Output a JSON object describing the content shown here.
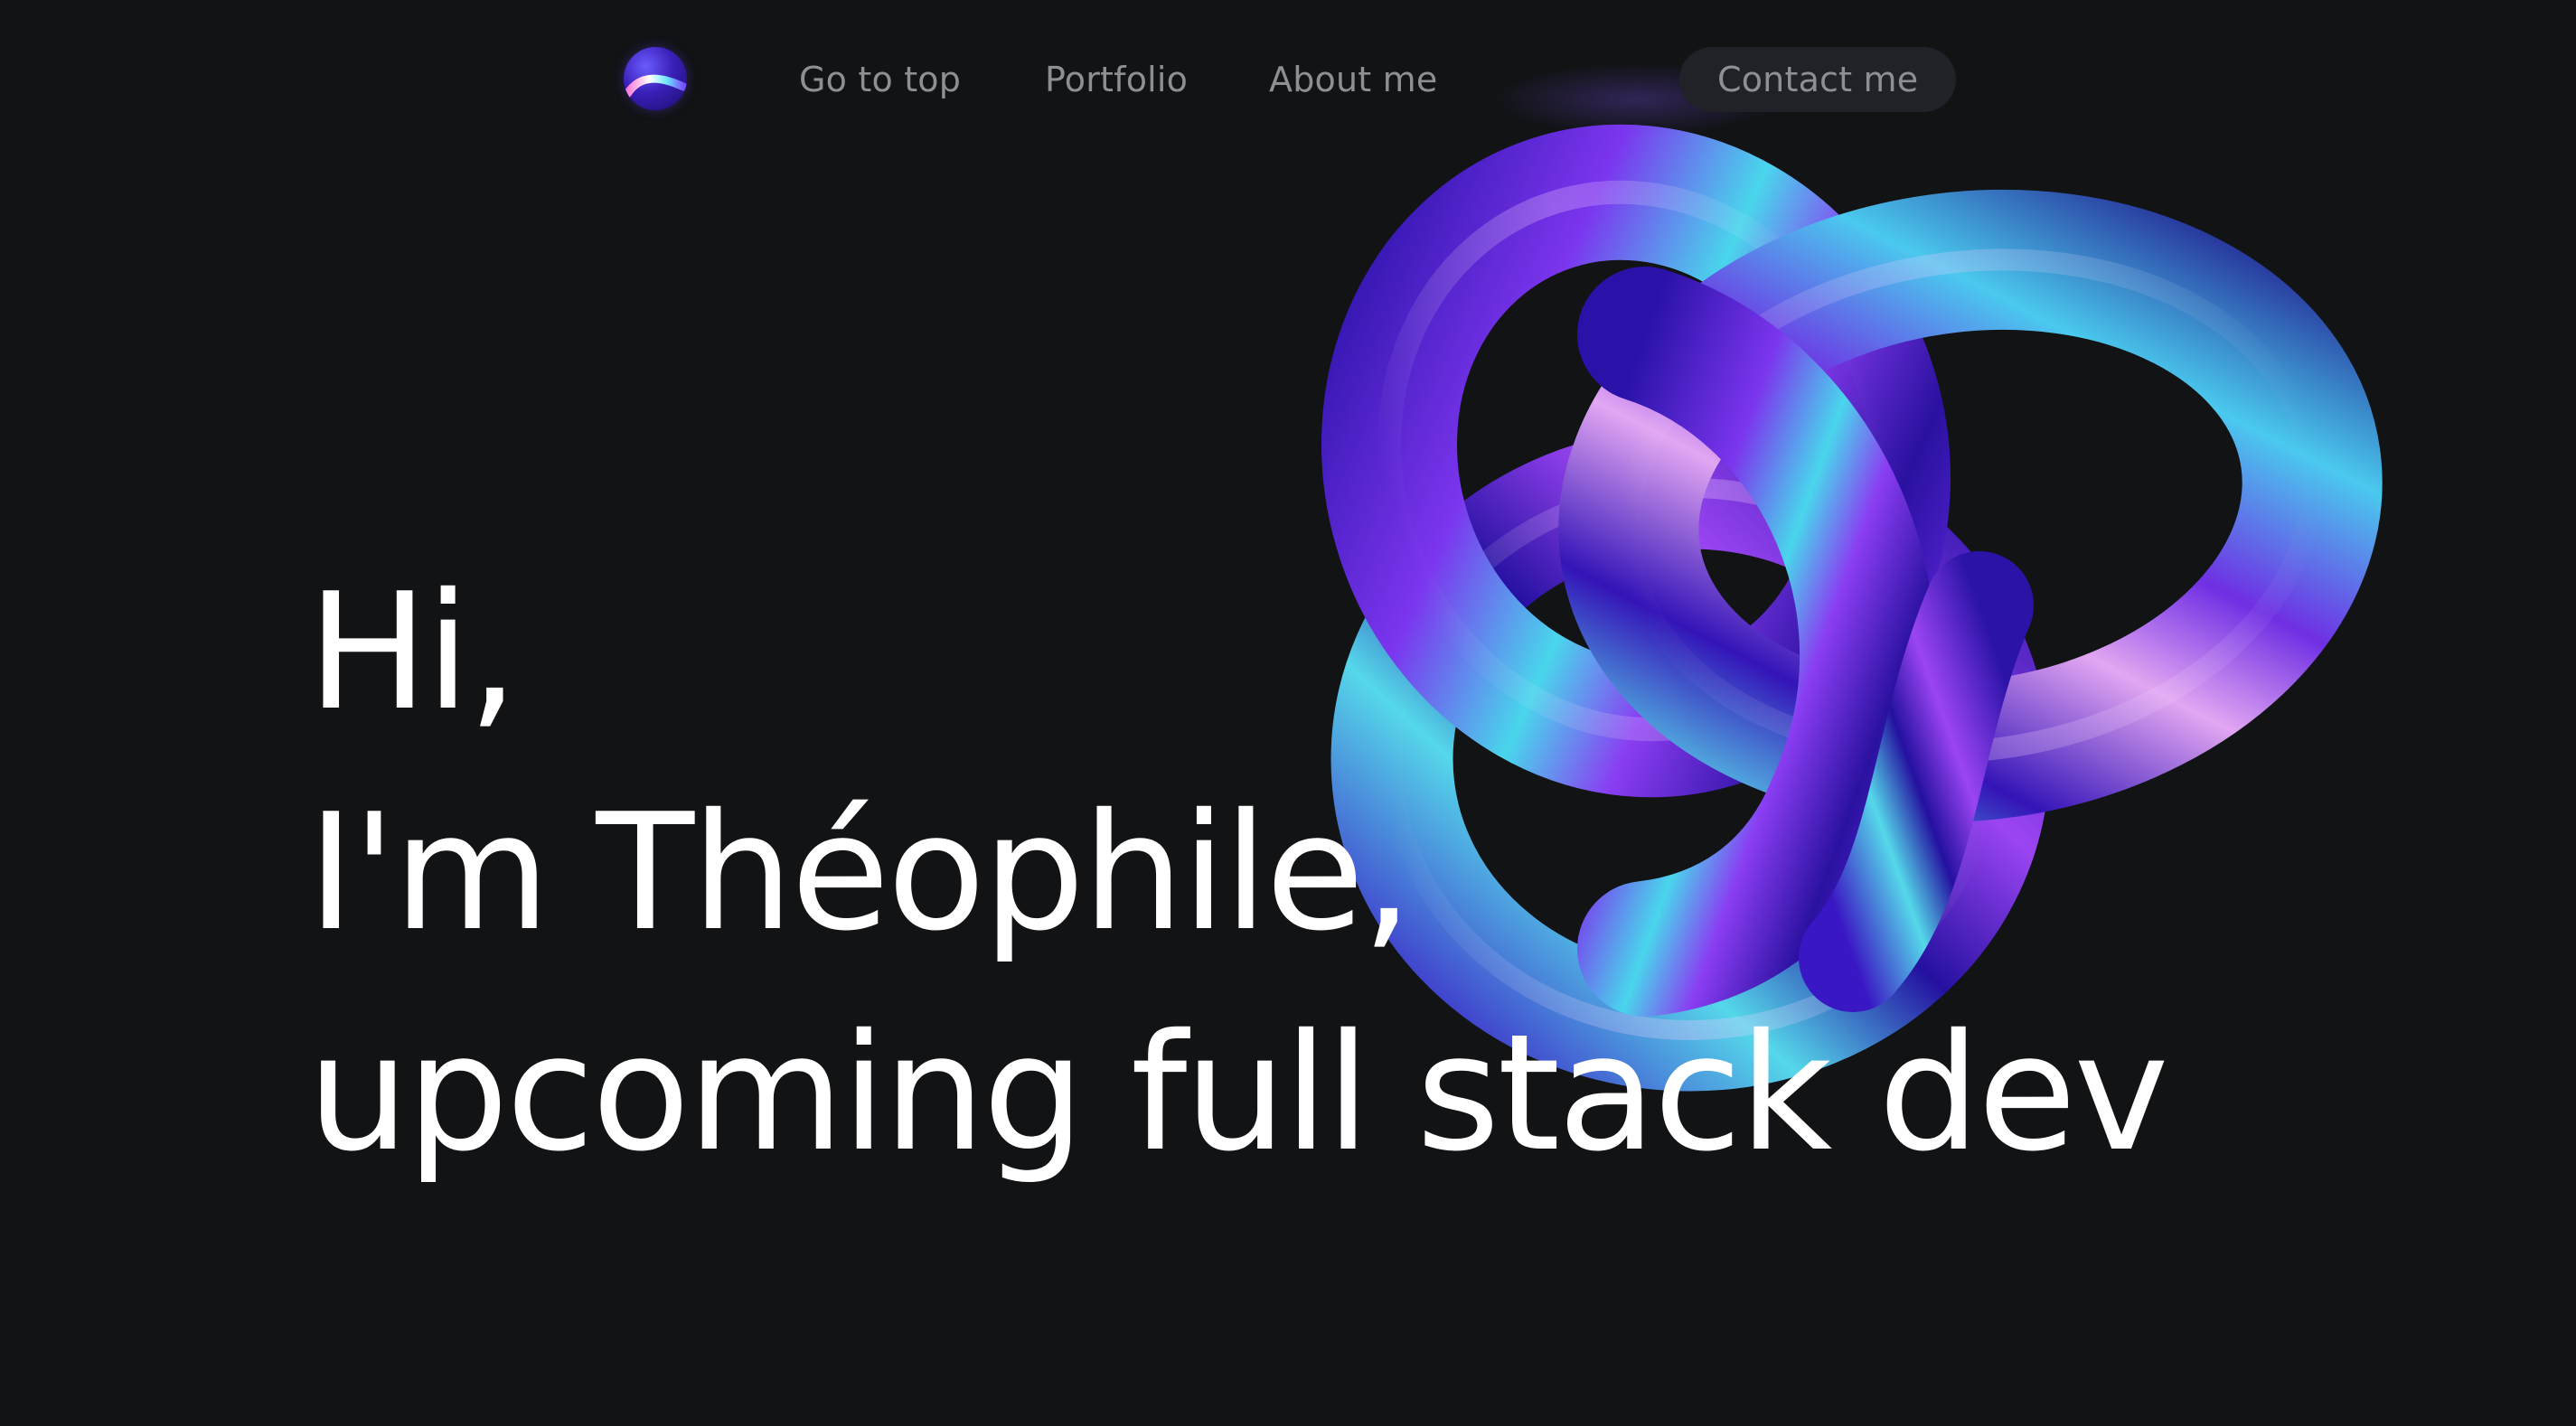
{
  "nav": {
    "logo_icon": "gradient-orb-logo-icon",
    "links": [
      {
        "label": "Go to top"
      },
      {
        "label": "Portfolio"
      },
      {
        "label": "About me"
      }
    ],
    "contact_label": "Contact me"
  },
  "hero": {
    "line1": "Hi,",
    "line2": "I'm Théophile,",
    "line3": "upcoming full stack dev"
  },
  "artwork": {
    "icon": "iridescent-trefoil-knot",
    "colors": {
      "deep": "#1f0f8a",
      "violet": "#6a2ee0",
      "purple": "#8b3cf0",
      "cyan": "#3fd3ea",
      "pink": "#e4a8f0"
    }
  },
  "colors": {
    "background": "#111315",
    "nav_text": "#8e8f93",
    "button_bg": "#212228",
    "hero_text": "#ffffff"
  }
}
